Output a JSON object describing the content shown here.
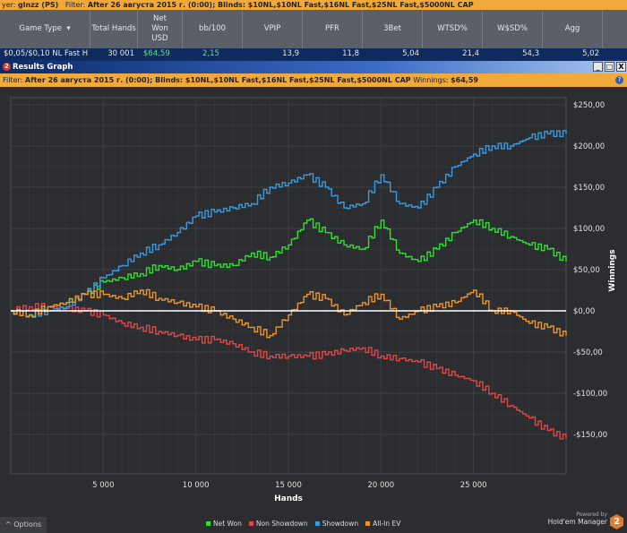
{
  "topbar": {
    "player_label": "yer:",
    "player": "glnzz (PS)",
    "filter_label": "Filter:",
    "filter": "After 26 августа 2015 г. (0:00); Blinds: $10NL,$10NL Fast,$16NL Fast,$25NL Fast,$5000NL CAP"
  },
  "table": {
    "headers": [
      "Game Type",
      "Total Hands",
      "Net Won USD",
      "bb/100",
      "VPIP",
      "PFR",
      "3Bet",
      "WTSD%",
      "W$SD%",
      "Agg"
    ],
    "row": [
      "$0,05/$0,10 NL Fast H",
      "30 001",
      "$64,59",
      "2,15",
      "13,9",
      "11,8",
      "5,04",
      "21,4",
      "54,3",
      "5,02"
    ]
  },
  "window": {
    "badge": "2",
    "title": "Results Graph",
    "minimize": "_",
    "maximize": "□",
    "close": "X"
  },
  "filterbar": {
    "filter_label": "Filter:",
    "filter": "After 26 августа 2015 г. (0:00); Blinds: $10NL,$10NL Fast,$16NL Fast,$25NL Fast,$5000NL CAP",
    "winnings_label": "Winnings:",
    "winnings": "$64,59",
    "help": "?"
  },
  "chart_data": {
    "type": "line",
    "xlabel": "Hands",
    "ylabel": "Winnings",
    "xlim": [
      0,
      30001
    ],
    "ylim": [
      -160,
      260
    ],
    "xticks": [
      5000,
      10000,
      15000,
      20000,
      25000
    ],
    "xtick_labels": [
      "5 000",
      "10 000",
      "15 000",
      "20 000",
      "25 000"
    ],
    "yticks": [
      250,
      200,
      150,
      100,
      50,
      0,
      -50,
      -100,
      -150
    ],
    "ytick_labels": [
      "$250,00",
      "$200,00",
      "$150,00",
      "$100,00",
      "$50,00",
      "$0,00",
      "-$50,00",
      "-$100,00",
      "-$150,00"
    ],
    "grid": true,
    "legend_position": "bottom",
    "x": [
      0,
      1000,
      2000,
      3000,
      4000,
      5000,
      6000,
      7000,
      8000,
      9000,
      10000,
      11000,
      12000,
      13000,
      14000,
      15000,
      16000,
      17000,
      18000,
      19000,
      20000,
      21000,
      22000,
      23000,
      24000,
      25000,
      26000,
      27000,
      28000,
      29000,
      30001
    ],
    "series": [
      {
        "name": "Net Won",
        "color": "#2fe02f",
        "values": [
          0,
          -5,
          5,
          10,
          20,
          35,
          40,
          45,
          55,
          50,
          60,
          55,
          55,
          70,
          65,
          80,
          110,
          95,
          80,
          75,
          110,
          70,
          60,
          75,
          95,
          110,
          100,
          90,
          80,
          75,
          60
        ]
      },
      {
        "name": "Non Showdown",
        "color": "#e04848",
        "values": [
          0,
          5,
          5,
          3,
          0,
          -5,
          -15,
          -20,
          -25,
          -30,
          -35,
          -35,
          -40,
          -50,
          -55,
          -55,
          -55,
          -53,
          -48,
          -45,
          -55,
          -58,
          -62,
          -70,
          -78,
          -85,
          -100,
          -115,
          -130,
          -145,
          -155
        ]
      },
      {
        "name": "Showdown",
        "color": "#3a9be0",
        "values": [
          0,
          -5,
          0,
          5,
          20,
          40,
          55,
          70,
          80,
          95,
          115,
          120,
          125,
          130,
          150,
          155,
          165,
          150,
          125,
          130,
          165,
          130,
          125,
          150,
          175,
          190,
          200,
          200,
          210,
          215,
          215
        ]
      },
      {
        "name": "All-In EV",
        "color": "#f0952a",
        "values": [
          0,
          -5,
          5,
          10,
          20,
          20,
          15,
          25,
          15,
          10,
          5,
          0,
          -10,
          -20,
          -30,
          -5,
          20,
          15,
          -5,
          10,
          20,
          -10,
          0,
          5,
          10,
          25,
          0,
          0,
          -15,
          -20,
          -30
        ]
      }
    ]
  },
  "footer": {
    "options": "^  Options",
    "powered_by": "Powered by",
    "brand": "Hold'em Manager",
    "brand_badge": "2"
  }
}
